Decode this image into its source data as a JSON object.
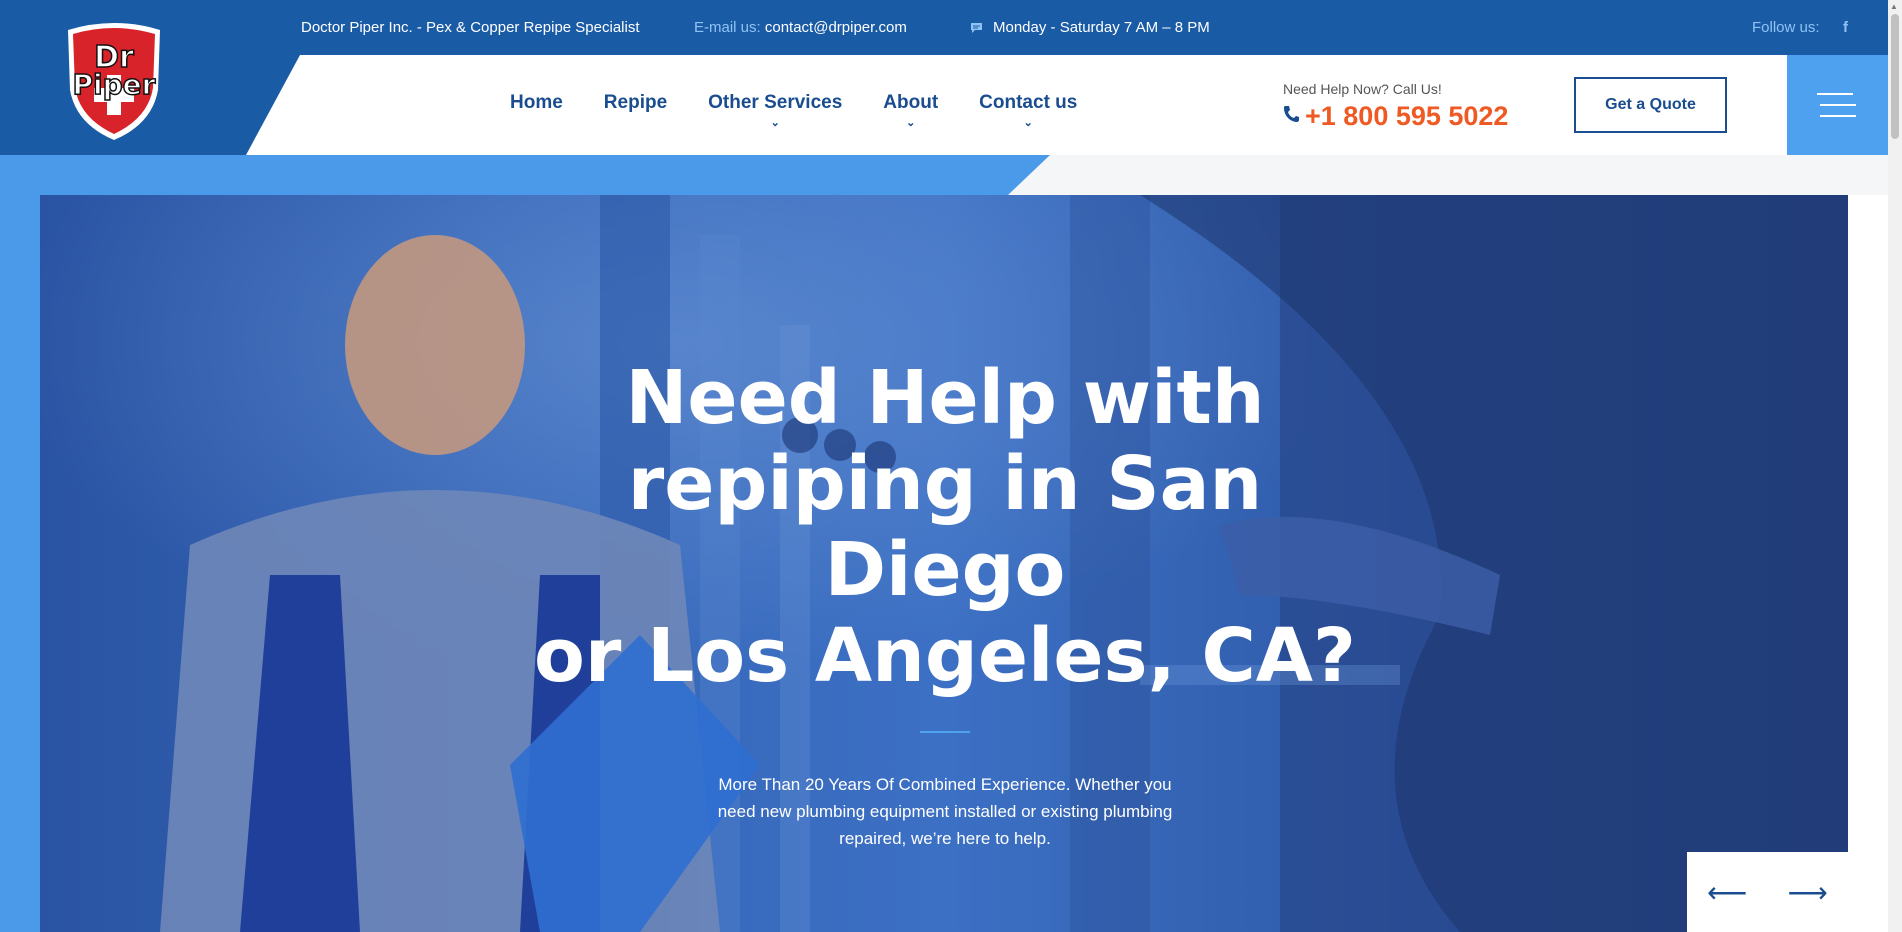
{
  "topbar": {
    "company": "Doctor Piper Inc. - Pex & Copper Repipe Specialist",
    "email_label": "E-mail us:",
    "email_value": "contact@drpiper.com",
    "hours": "Monday - Saturday 7 AM – 8 PM",
    "follow_label": "Follow us:",
    "facebook_glyph": "f"
  },
  "logo": {
    "line1": "Dr",
    "line2": "Piper"
  },
  "nav": {
    "items": [
      {
        "label": "Home"
      },
      {
        "label": "Repipe"
      },
      {
        "label": "Other Services"
      },
      {
        "label": "About"
      },
      {
        "label": "Contact us"
      }
    ]
  },
  "call": {
    "label": "Need Help Now? Call Us!",
    "number": "+1 800 595 5022"
  },
  "quote_button": "Get a Quote",
  "hero": {
    "title_line1": "Need Help with",
    "title_line2": "repiping in San Diego",
    "title_line3": "or Los Angeles, CA?",
    "subtitle": "More Than 20 Years Of Combined Experience. Whether you need new plumbing equipment installed or existing plumbing repaired, we’re here to help."
  },
  "slider": {
    "prev": "⟵",
    "next": "⟶"
  },
  "colors": {
    "brand_blue": "#1a5ba6",
    "light_blue": "#4ea1ee",
    "accent_orange": "#ef5a24",
    "nav_text": "#1a4d8f"
  },
  "icons": [
    "chat-icon",
    "facebook-icon",
    "phone-icon",
    "menu-icon",
    "arrow-left-icon",
    "arrow-right-icon",
    "chevron-down-icon"
  ]
}
